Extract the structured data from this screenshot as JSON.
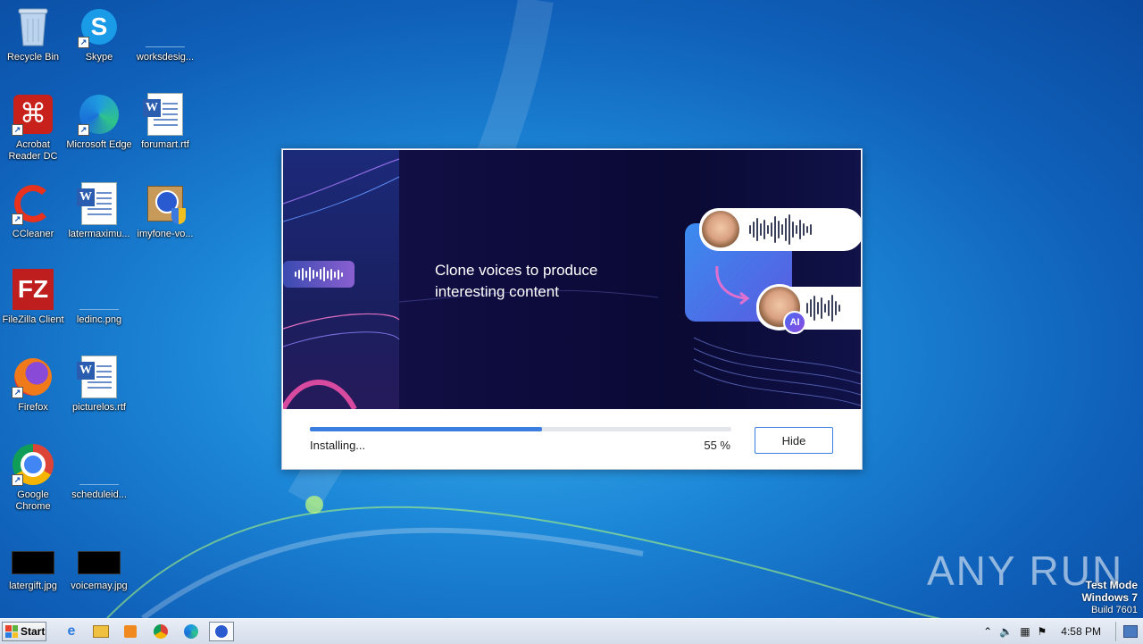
{
  "desktop": {
    "icons": [
      {
        "label": "Recycle Bin"
      },
      {
        "label": "Skype"
      },
      {
        "label": "worksdesig..."
      },
      {
        "label": "Acrobat Reader DC"
      },
      {
        "label": "Microsoft Edge"
      },
      {
        "label": "forumart.rtf"
      },
      {
        "label": "CCleaner"
      },
      {
        "label": "latermaximu..."
      },
      {
        "label": "imyfone-vo..."
      },
      {
        "label": "FileZilla Client"
      },
      {
        "label": "ledinc.png"
      },
      {
        "label": "Firefox"
      },
      {
        "label": "picturelos.rtf"
      },
      {
        "label": "Google Chrome"
      },
      {
        "label": "scheduleid..."
      },
      {
        "label": "latergift.jpg"
      },
      {
        "label": "voicemay.jpg"
      }
    ]
  },
  "installer": {
    "banner_text_line1": "Clone voices to produce",
    "banner_text_line2": "interesting content",
    "ai_badge": "AI",
    "status": "Installing...",
    "progress_percent": 55,
    "progress_label": "55 %",
    "hide_label": "Hide"
  },
  "watermark": {
    "brand": "ANY RUN",
    "mode": "Test Mode",
    "os": "Windows 7",
    "build": "Build 7601"
  },
  "taskbar": {
    "start_label": "Start",
    "clock": "4:58 PM"
  },
  "colors": {
    "accent": "#3b7ee0",
    "banner_bg": "#0d0b3c"
  }
}
